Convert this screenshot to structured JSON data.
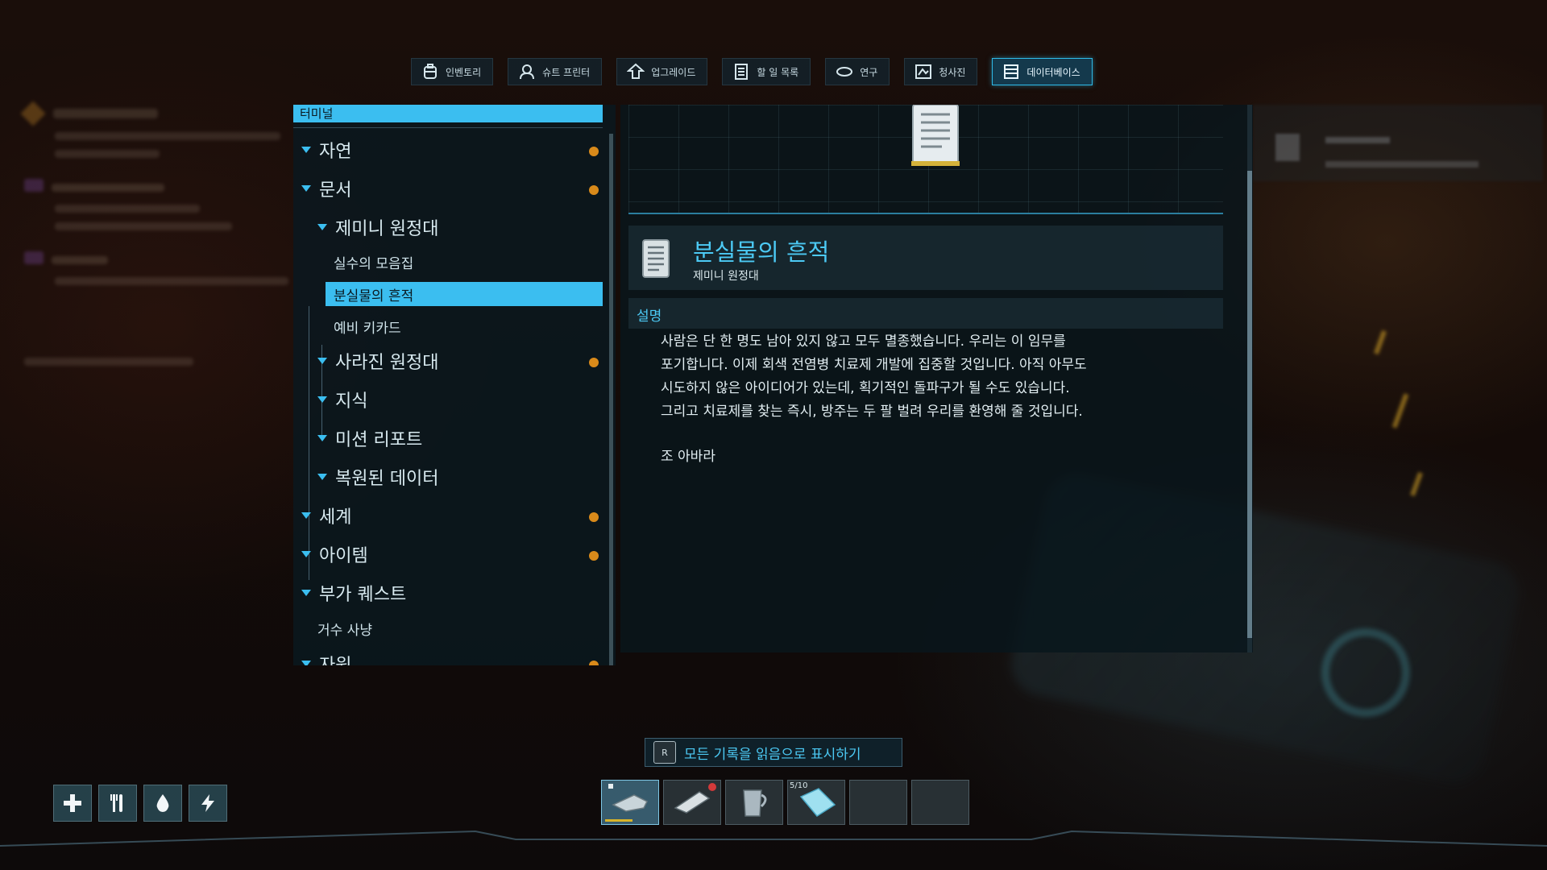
{
  "tabs": [
    {
      "label": "인벤토리",
      "icon": "backpack-icon"
    },
    {
      "label": "슈트 프린터",
      "icon": "suit-printer-icon"
    },
    {
      "label": "업그레이드",
      "icon": "upgrade-icon"
    },
    {
      "label": "할 일 목록",
      "icon": "checklist-icon"
    },
    {
      "label": "연구",
      "icon": "research-icon"
    },
    {
      "label": "청사진",
      "icon": "blueprint-icon"
    },
    {
      "label": "데이터베이스",
      "icon": "database-icon",
      "active": true
    }
  ],
  "tree": {
    "header": "터미널",
    "items": [
      {
        "label": "자연",
        "level": 1,
        "new": true
      },
      {
        "label": "문서",
        "level": 1,
        "new": true
      },
      {
        "label": "제미니 원정대",
        "level": 2,
        "new": false
      },
      {
        "label": "실수의 모음집",
        "level": 3
      },
      {
        "label": "분실물의 흔적",
        "level": 3,
        "selected": true
      },
      {
        "label": "예비 키카드",
        "level": 3
      },
      {
        "label": "사라진 원정대",
        "level": 2,
        "new": true
      },
      {
        "label": "지식",
        "level": 2
      },
      {
        "label": "미션 리포트",
        "level": 2
      },
      {
        "label": "복원된 데이터",
        "level": 2
      },
      {
        "label": "세계",
        "level": 1,
        "new": true
      },
      {
        "label": "아이템",
        "level": 1,
        "new": true
      },
      {
        "label": "부가 퀘스트",
        "level": 1
      },
      {
        "label": "거수 사냥",
        "level": 3
      },
      {
        "label": "자원",
        "level": 1,
        "new": true
      }
    ]
  },
  "entry": {
    "title": "분실물의 흔적",
    "category": "제미니 원정대",
    "desc_header": "설명",
    "body": [
      "사람은 단 한 명도 남아 있지 않고 모두 멸종했습니다. 우리는 이 임무를",
      "포기합니다. 이제 회색 전염병 치료제 개발에 집중할 것입니다. 아직 아무도",
      "시도하지 않은 아이디어가 있는데, 획기적인 돌파구가 될 수도 있습니다.",
      "그리고 치료제를 찾는 즉시, 방주는 두 팔 벌려 우리를 환영해 줄 것입니다."
    ],
    "signature": "조 아바라"
  },
  "mark_all": {
    "key": "R",
    "label": "모든 기록을 읽음으로 표시하기"
  },
  "status_icons": [
    "health-icon",
    "food-icon",
    "water-icon",
    "energy-icon"
  ],
  "hotbar": [
    {
      "item": "multitool",
      "active": true,
      "durability": 0.55
    },
    {
      "item": "scanner",
      "active": false,
      "alert": true
    },
    {
      "item": "mug",
      "active": false
    },
    {
      "item": "ice-crystal",
      "active": false,
      "count": "5/10"
    },
    {
      "item": "empty",
      "active": false
    },
    {
      "item": "empty",
      "active": false
    }
  ],
  "colors": {
    "accent": "#3bbef0",
    "new_dot": "#d98a1a",
    "title": "#4ccaf5"
  }
}
